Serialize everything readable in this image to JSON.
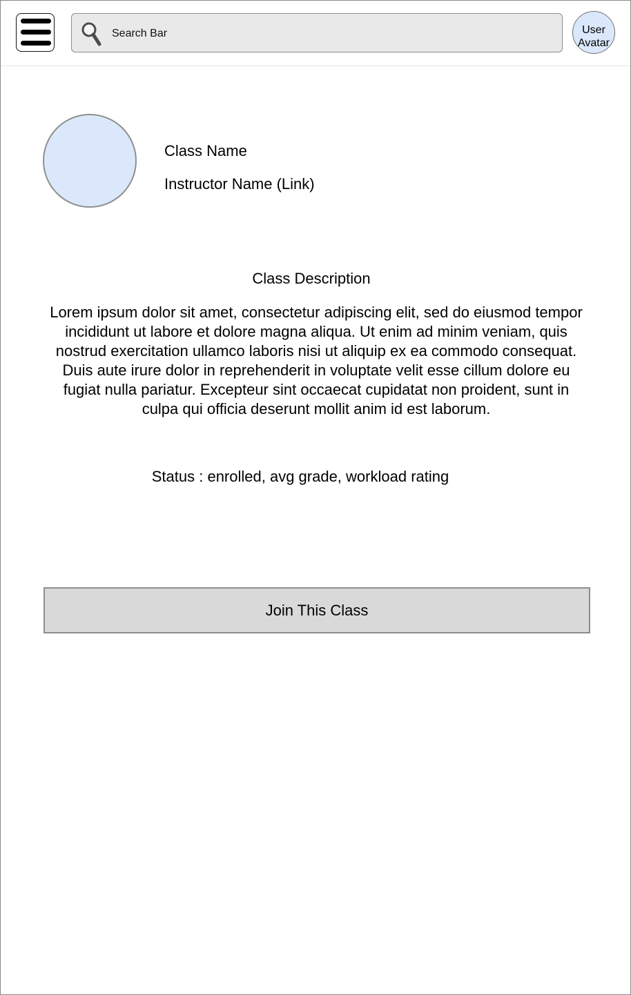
{
  "header": {
    "menu_icon": "hamburger-menu-icon",
    "search": {
      "label": "Search Bar",
      "icon": "search-icon"
    },
    "user_avatar": {
      "line1": "User",
      "line2": "Avatar"
    }
  },
  "class": {
    "image_icon": "class-image-placeholder",
    "name": "Class Name",
    "instructor": "Instructor Name (Link)",
    "description_heading": "Class Description",
    "description": "Lorem ipsum dolor sit amet, consectetur adipiscing elit, sed do eiusmod tempor incididunt ut labore et dolore magna aliqua. Ut enim ad minim veniam, quis nostrud exercitation ullamco laboris nisi ut aliquip ex ea commodo consequat. Duis aute irure dolor in reprehenderit in voluptate velit esse cillum dolore eu fugiat nulla pariatur. Excepteur sint occaecat cupidatat non proident, sunt in culpa qui officia deserunt mollit anim id est laborum.",
    "status": "Status : enrolled, avg grade, workload rating",
    "join_button_label": "Join This Class"
  },
  "colors": {
    "avatar_fill": "#dbe8fb",
    "search_fill": "#e9e9e9",
    "button_fill": "#d9d9d9",
    "border": "#8d8d8d"
  }
}
